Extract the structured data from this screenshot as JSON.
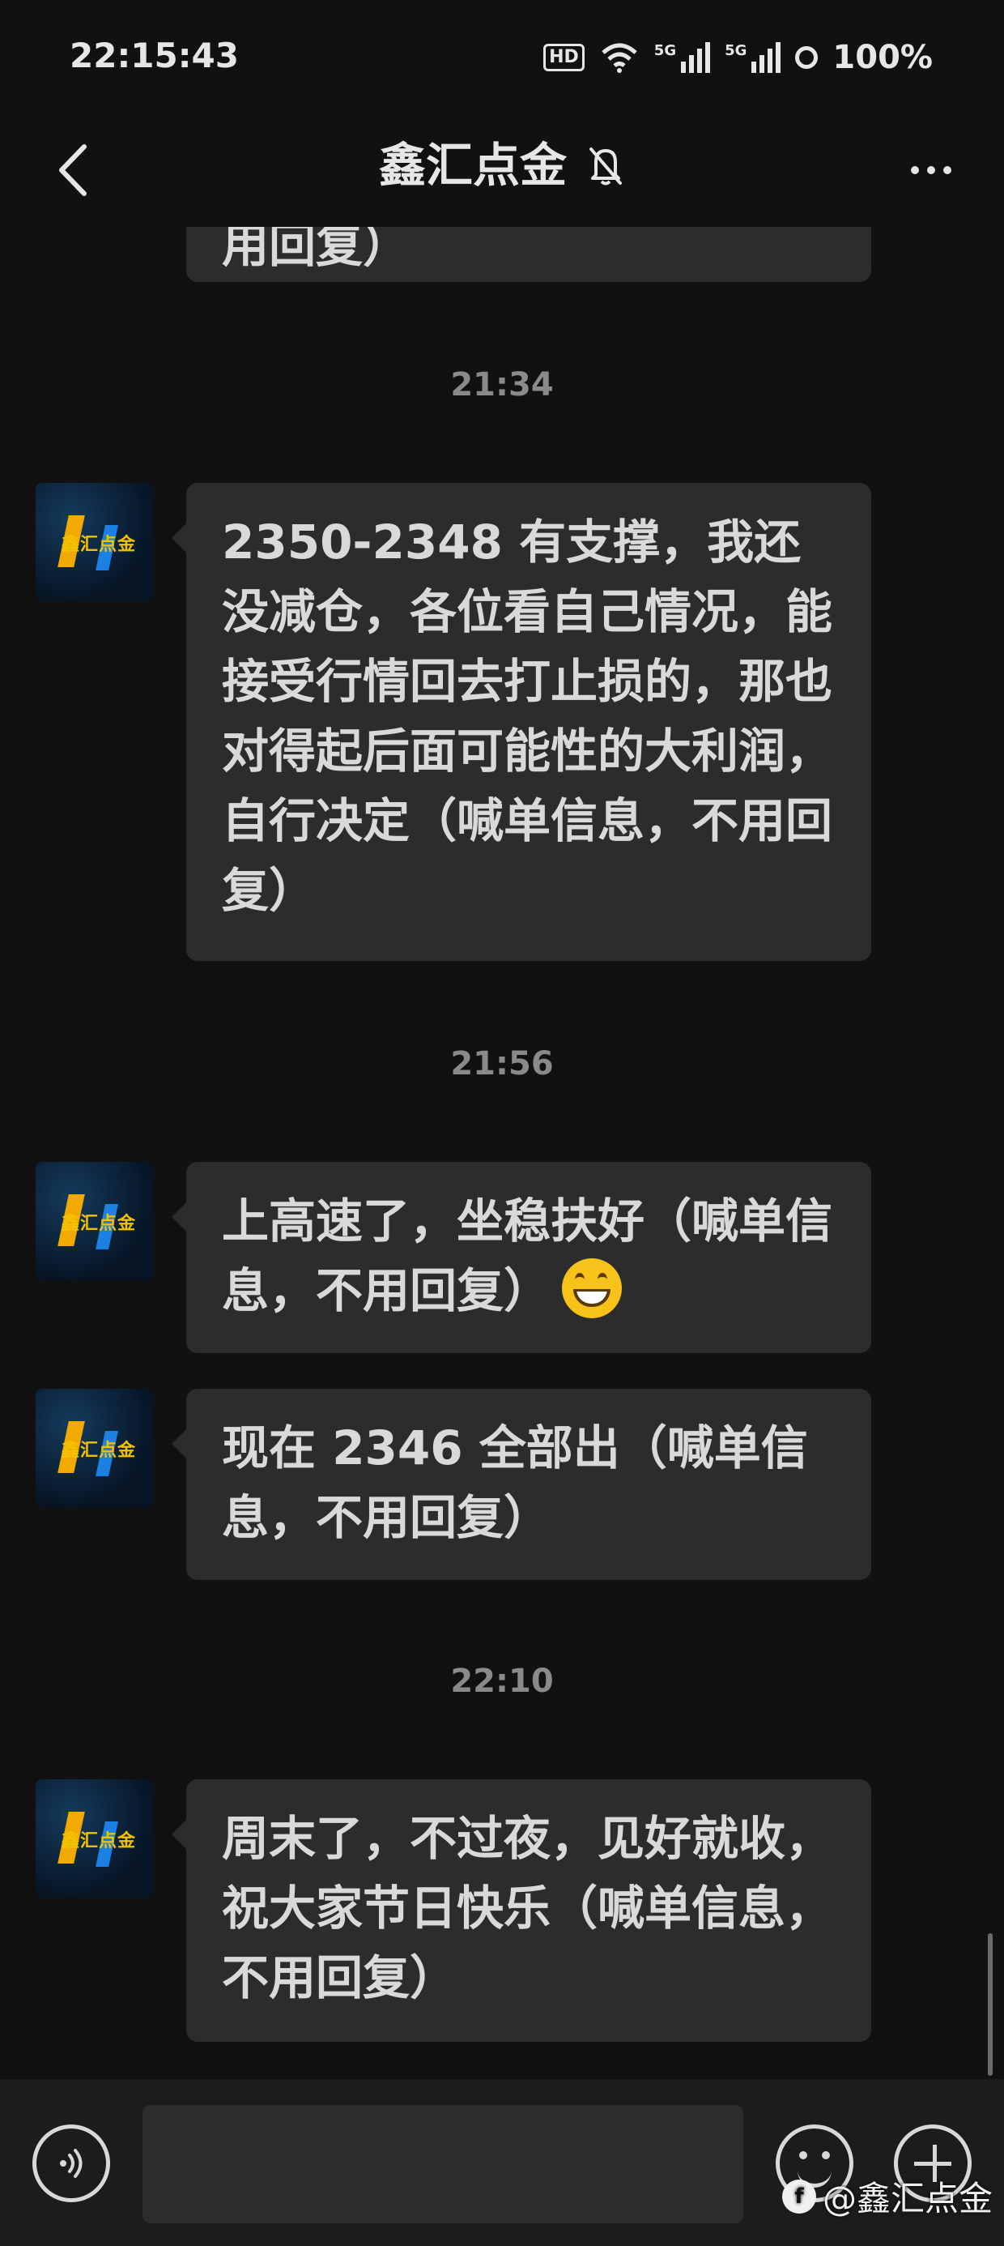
{
  "status_bar": {
    "time": "22:15:43",
    "hd_badge": "HD",
    "network_1": "5G",
    "network_2": "5G",
    "battery": "100%"
  },
  "header": {
    "title": "鑫汇点金",
    "muted_icon": "bell-off-icon",
    "back_icon": "chevron-left-icon",
    "more_icon": "more-horizontal-icon"
  },
  "messages": [
    {
      "type": "partial_bubble",
      "text": "用回复）"
    },
    {
      "type": "timestamp",
      "text": "21:34"
    },
    {
      "type": "bubble",
      "sender_avatar": "鑫汇点金",
      "text": "2350-2348 有支撑，我还没减仓，各位看自己情况，能接受行情回去打止损的，那也对得起后面可能性的大利润，自行决定（喊单信息，不用回复）"
    },
    {
      "type": "timestamp",
      "text": "21:56"
    },
    {
      "type": "bubble",
      "sender_avatar": "鑫汇点金",
      "text": "上高速了，坐稳扶好（喊单信息，不用回复）",
      "emoji": "grinning-face-emoji"
    },
    {
      "type": "bubble",
      "sender_avatar": "鑫汇点金",
      "text": "现在 2346 全部出（喊单信息，不用回复）"
    },
    {
      "type": "timestamp",
      "text": "22:10"
    },
    {
      "type": "bubble",
      "sender_avatar": "鑫汇点金",
      "text": "周末了，不过夜，见好就收，祝大家节日快乐（喊单信息，不用回复）"
    }
  ],
  "input_bar": {
    "voice_icon": "voice-icon",
    "placeholder": "",
    "emoji_icon": "emoji-icon",
    "plus_icon": "plus-icon"
  },
  "watermark": {
    "text": "@鑫汇点金"
  },
  "colors": {
    "background": "#111111",
    "bubble": "#2c2c2c",
    "text": "#d9d9d9",
    "timestamp": "#8a8a8a",
    "input_bar": "#1c1c1c"
  }
}
